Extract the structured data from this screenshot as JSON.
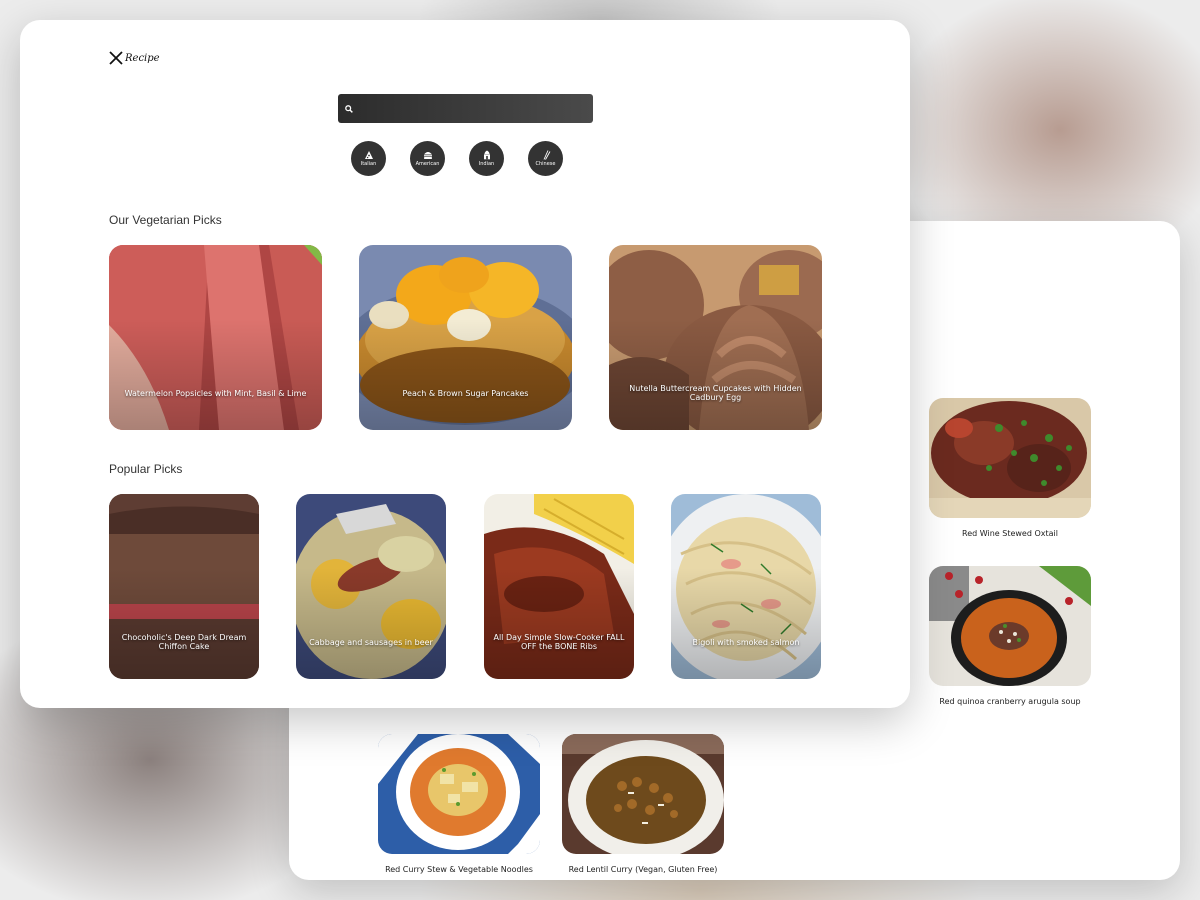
{
  "app": {
    "logo_text": "Recipe"
  },
  "search": {
    "placeholder": "",
    "value": ""
  },
  "cuisines": [
    {
      "label": "Italian",
      "icon": "pizza-icon"
    },
    {
      "label": "American",
      "icon": "burger-icon"
    },
    {
      "label": "Indian",
      "icon": "temple-icon"
    },
    {
      "label": "Chinese",
      "icon": "chopsticks-icon"
    }
  ],
  "sections": {
    "vegetarian": {
      "title": "Our Vegetarian Picks",
      "items": [
        {
          "title": "Watermelon Popsicles with Mint, Basil & Lime"
        },
        {
          "title": "Peach & Brown Sugar Pancakes"
        },
        {
          "title": "Nutella Buttercream Cupcakes with Hidden Cadbury Egg"
        }
      ]
    },
    "popular": {
      "title": "Popular Picks",
      "items": [
        {
          "title": "Chocoholic's Deep Dark Dream Chiffon Cake"
        },
        {
          "title": "Cabbage and sausages in beer"
        },
        {
          "title": "All Day Simple Slow-Cooker FALL OFF the BONE Ribs"
        },
        {
          "title": "Bigoli with smoked salmon"
        }
      ]
    }
  },
  "results": [
    {
      "title": "Red Wine Stewed Oxtail"
    },
    {
      "title": "Red quinoa cranberry arugula soup"
    },
    {
      "title": "Red Curry Stew & Vegetable Noodles"
    },
    {
      "title": "Red Lentil Curry (Vegan, Gluten Free)"
    }
  ]
}
